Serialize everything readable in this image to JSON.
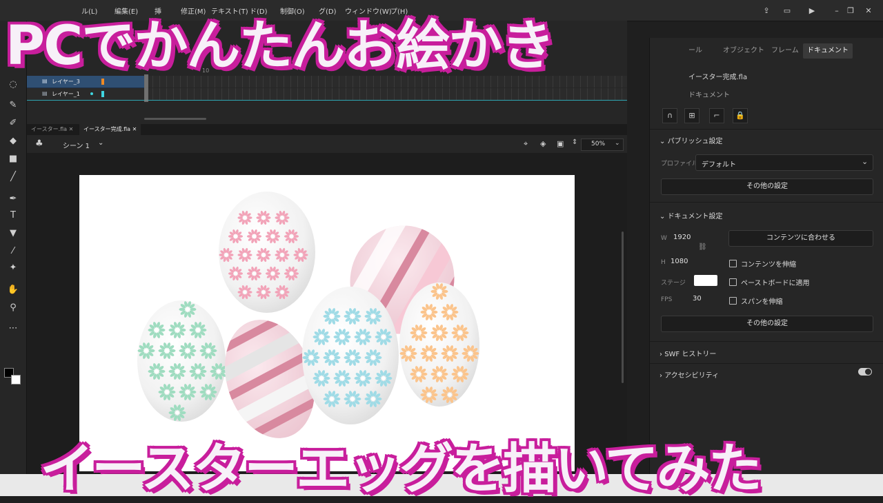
{
  "overlay": {
    "title_top": "PCでかんたんお絵かき",
    "title_bottom": "イースターエッグを描いてみた",
    "accent_color": "#c81e9c"
  },
  "menubar": {
    "items": [
      "ル(L)",
      "編集(E)",
      "挿",
      "修正(M)",
      "テキスト(T)",
      "ド(D)",
      "制御(O)",
      "グ(D)",
      "ウィンドウ(W)",
      "プ(H)"
    ]
  },
  "timeline": {
    "frame_marker": "10",
    "layers": [
      {
        "name": "レイヤー_3"
      },
      {
        "name": "レイヤー_1"
      }
    ]
  },
  "doc_tabs": [
    {
      "label": "イースター.fla",
      "active": false
    },
    {
      "label": "イースター完成.fla",
      "active": true
    }
  ],
  "scene": {
    "label": "シーン 1",
    "zoom": "50%"
  },
  "panel": {
    "tabs": [
      "ール",
      "オブジェクト",
      "フレーム",
      "ドキュメント"
    ],
    "active_tab": "ドキュメント",
    "file_name": "イースター完成.fla",
    "doc_type": "ドキュメント",
    "publish": {
      "header": "パブリッシュ設定",
      "profile_label": "プロファイル",
      "profile_value": "デフォルト",
      "more_settings": "その他の設定"
    },
    "document": {
      "header": "ドキュメント設定",
      "w_label": "W",
      "w_value": "1920",
      "h_label": "H",
      "h_value": "1080",
      "fit_button": "コンテンツに合わせる",
      "stage_label": "ステージ",
      "stage_color": "#ffffff",
      "fps_label": "FPS",
      "fps_value": "30",
      "checks": [
        "コンテンツを伸縮",
        "ペーストボードに適用",
        "スパンを伸縮"
      ],
      "more_settings": "その他の設定"
    },
    "swf_history": "SWF ヒストリー",
    "accessibility": "アクセシビリティ"
  },
  "egg_colors": {
    "pink": "#f2a3b8",
    "green": "#9fdcc0",
    "blue": "#9fdbe6",
    "orange": "#fbc48c",
    "stripe": "#d8899f"
  }
}
